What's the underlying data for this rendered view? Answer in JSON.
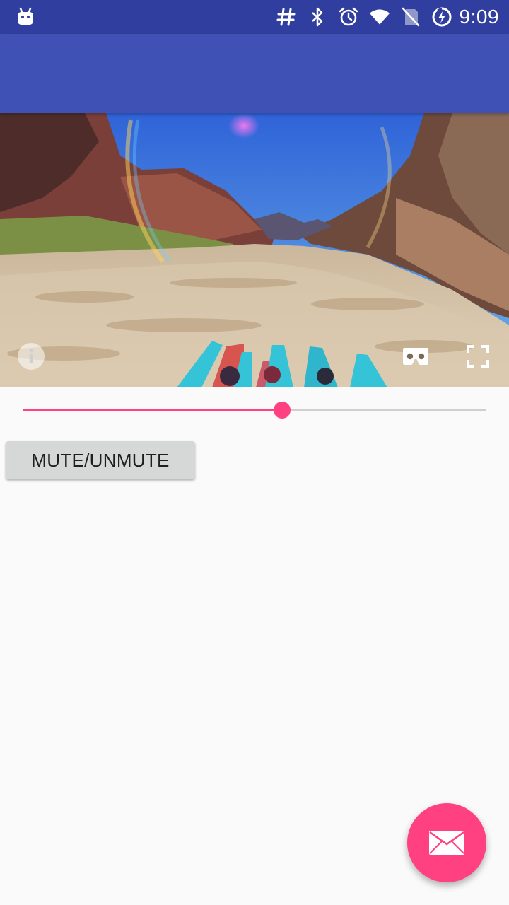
{
  "status_bar": {
    "time": "9:09",
    "icons": [
      "android-debug-icon",
      "hash-icon",
      "bluetooth-icon",
      "alarm-icon",
      "wifi-icon",
      "no-sim-icon",
      "battery-charging-icon"
    ]
  },
  "app_bar": {
    "title": ""
  },
  "video_player": {
    "controls": [
      "info-icon",
      "cardboard-vr-icon",
      "fullscreen-icon"
    ],
    "progress": 0.56
  },
  "mute_button": {
    "label": "MUTE/UNMUTE"
  },
  "fab": {
    "icon": "email-icon"
  },
  "colors": {
    "status_bar": "#303f9f",
    "app_bar": "#3f51b5",
    "accent": "#ff4081",
    "background": "#fafafa",
    "button": "#d6d7d7"
  }
}
